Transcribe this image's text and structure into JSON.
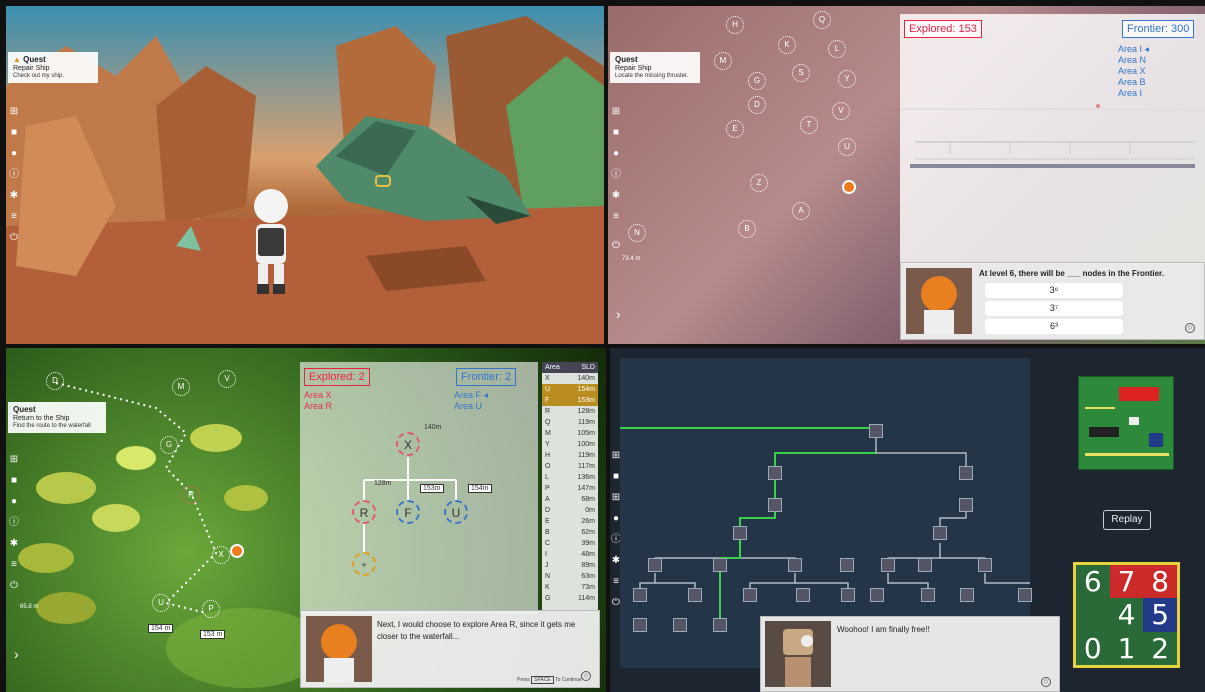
{
  "panels": {
    "p1": {
      "quest": {
        "title": "Quest",
        "name": "Repair Ship",
        "desc": "Check out my ship."
      }
    },
    "p2": {
      "quest": {
        "title": "Quest",
        "name": "Repair Ship",
        "desc": "Locate the missing thruster."
      },
      "explored": "Explored: 153",
      "frontier": "Frontier: 300",
      "frontier_areas": [
        "Area I",
        "Area N",
        "Area X",
        "Area B",
        "Area I"
      ],
      "map_nodes": [
        "H",
        "Q",
        "M",
        "K",
        "L",
        "G",
        "S",
        "D",
        "Y",
        "V",
        "E",
        "U",
        "T",
        "Z",
        "N",
        "A",
        "B"
      ],
      "distance": "73.4 m",
      "question": "At level 6, there will be ___ nodes in the Frontier.",
      "answers": [
        "3⁶",
        "3⁷",
        "6³"
      ]
    },
    "p3": {
      "quest": {
        "title": "Quest",
        "name": "Return to the Ship",
        "desc": "Find the route to the waterfall"
      },
      "explored": "Explored: 2",
      "frontier": "Frontier: 2",
      "explored_areas": [
        "Area X",
        "Area R"
      ],
      "frontier_areas": [
        "Area F",
        "Area U"
      ],
      "tree": {
        "root": "X",
        "root_dist": "140m",
        "children": [
          "R",
          "F",
          "U"
        ],
        "r_dist": "128m",
        "f_dist": "153m",
        "u_dist": "154m",
        "new": "+"
      },
      "map_nodes": [
        "D",
        "M",
        "V",
        "G",
        "R",
        "X",
        "U",
        "P"
      ],
      "map_dist1": "154 m",
      "map_dist2": "153 m",
      "distance": "65.8 m",
      "sld_header": [
        "Area",
        "SLD"
      ],
      "sld_rows": [
        [
          "X",
          "140m"
        ],
        [
          "U",
          "154m"
        ],
        [
          "F",
          "153m"
        ],
        [
          "R",
          "128m"
        ],
        [
          "Q",
          "119m"
        ],
        [
          "M",
          "105m"
        ],
        [
          "Y",
          "100m"
        ],
        [
          "H",
          "119m"
        ],
        [
          "O",
          "117m"
        ],
        [
          "L",
          "136m"
        ],
        [
          "P",
          "147m"
        ],
        [
          "A",
          "68m"
        ],
        [
          "D",
          "0m"
        ],
        [
          "E",
          "26m"
        ],
        [
          "B",
          "62m"
        ],
        [
          "C",
          "39m"
        ],
        [
          "I",
          "48m"
        ],
        [
          "J",
          "89m"
        ],
        [
          "N",
          "63m"
        ],
        [
          "K",
          "73m"
        ],
        [
          "G",
          "114m"
        ]
      ],
      "dialog": "Next, I would choose to explore Area R, since it gets me closer to the waterfall...",
      "press": "Press",
      "space": "SPACE",
      "to_continue": "To Continue"
    },
    "p4": {
      "replay": "Replay",
      "keypad": [
        "6",
        "7",
        "8",
        "",
        "4",
        "5",
        "0",
        "1",
        "2"
      ],
      "dialog": "Woohoo! I am finally free!!"
    }
  },
  "colors": {
    "explored": "#e2304a",
    "frontier": "#3a78c8",
    "path": "#39d14a",
    "keypad_border": "#e6d23a"
  }
}
